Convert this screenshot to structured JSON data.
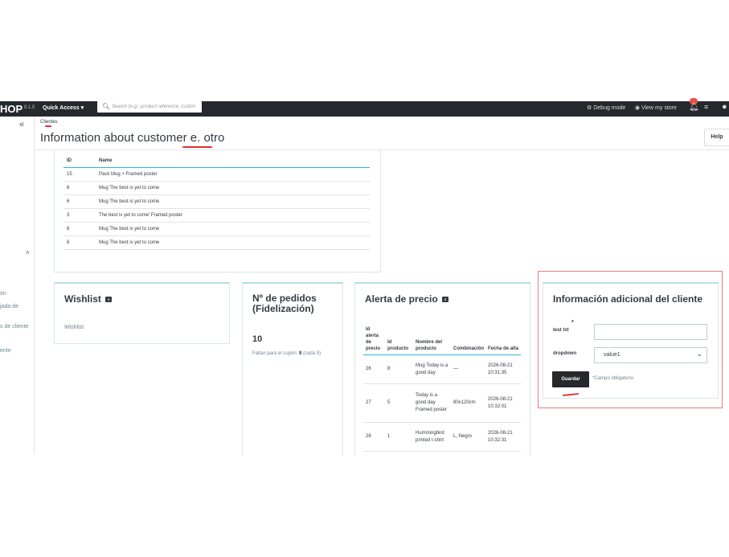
{
  "topbar": {
    "logo": "HOP",
    "version": "8.1.5",
    "quick_access": "Quick Access ▾",
    "search_placeholder": "Search (e.g.: product reference, custon",
    "debug_mode": "Debug mode",
    "view_store": "View my store"
  },
  "sidebar": {
    "items": [
      "ón",
      "jada de",
      "s de cliente",
      "ente"
    ]
  },
  "header": {
    "breadcrumb": "Clientes",
    "title": "Information about customer e. otro",
    "help": "Help"
  },
  "products": {
    "columns": [
      "ID",
      "Name"
    ],
    "rows": [
      {
        "id": "15",
        "name": "Pack Mug + Framed poster"
      },
      {
        "id": "6",
        "name": "Mug The best is yet to come"
      },
      {
        "id": "6",
        "name": "Mug The best is yet to come"
      },
      {
        "id": "3",
        "name": "The best is yet to come' Framed poster"
      },
      {
        "id": "6",
        "name": "Mug The best is yet to come"
      },
      {
        "id": "6",
        "name": "Mug The best is yet to come"
      }
    ]
  },
  "wishlist": {
    "title": "Wishlist",
    "count": "0",
    "item": "Wishlist"
  },
  "orders": {
    "title_line1": "Nº de pedidos",
    "title_line2": "(Fidelización)",
    "count": "10",
    "note_prefix": "Faltan para el cupón: ",
    "note_bold": "8",
    "note_suffix": " (cada 9)"
  },
  "price_alert": {
    "title": "Alerta de precio",
    "count": "3",
    "columns": [
      "Id alerta de precio",
      "Id producto",
      "Nombre del producto",
      "Combinación",
      "Fecha de alta"
    ],
    "rows": [
      {
        "id": "26",
        "product_id": "8",
        "name": "Mug Today is a good day",
        "combination": "—",
        "date": "2026-08-21 10:31:35"
      },
      {
        "id": "27",
        "product_id": "5",
        "name": "Today is a good day Framed poster",
        "combination": "80x120cm",
        "date": "2026-08-21 10:32:01"
      },
      {
        "id": "28",
        "product_id": "1",
        "name": "Hummingbird printed t-shirt",
        "combination": "L, Negro",
        "date": "2026-08-21 10:32:31"
      }
    ]
  },
  "additional_info": {
    "title": "Información adicional del cliente",
    "field1_label": "test txt",
    "field1_required": "*",
    "field1_value": "",
    "field2_label": "dropdown",
    "field2_value": "value1",
    "save_label": "Guardar",
    "required_note": "*Campo obligatorio"
  }
}
